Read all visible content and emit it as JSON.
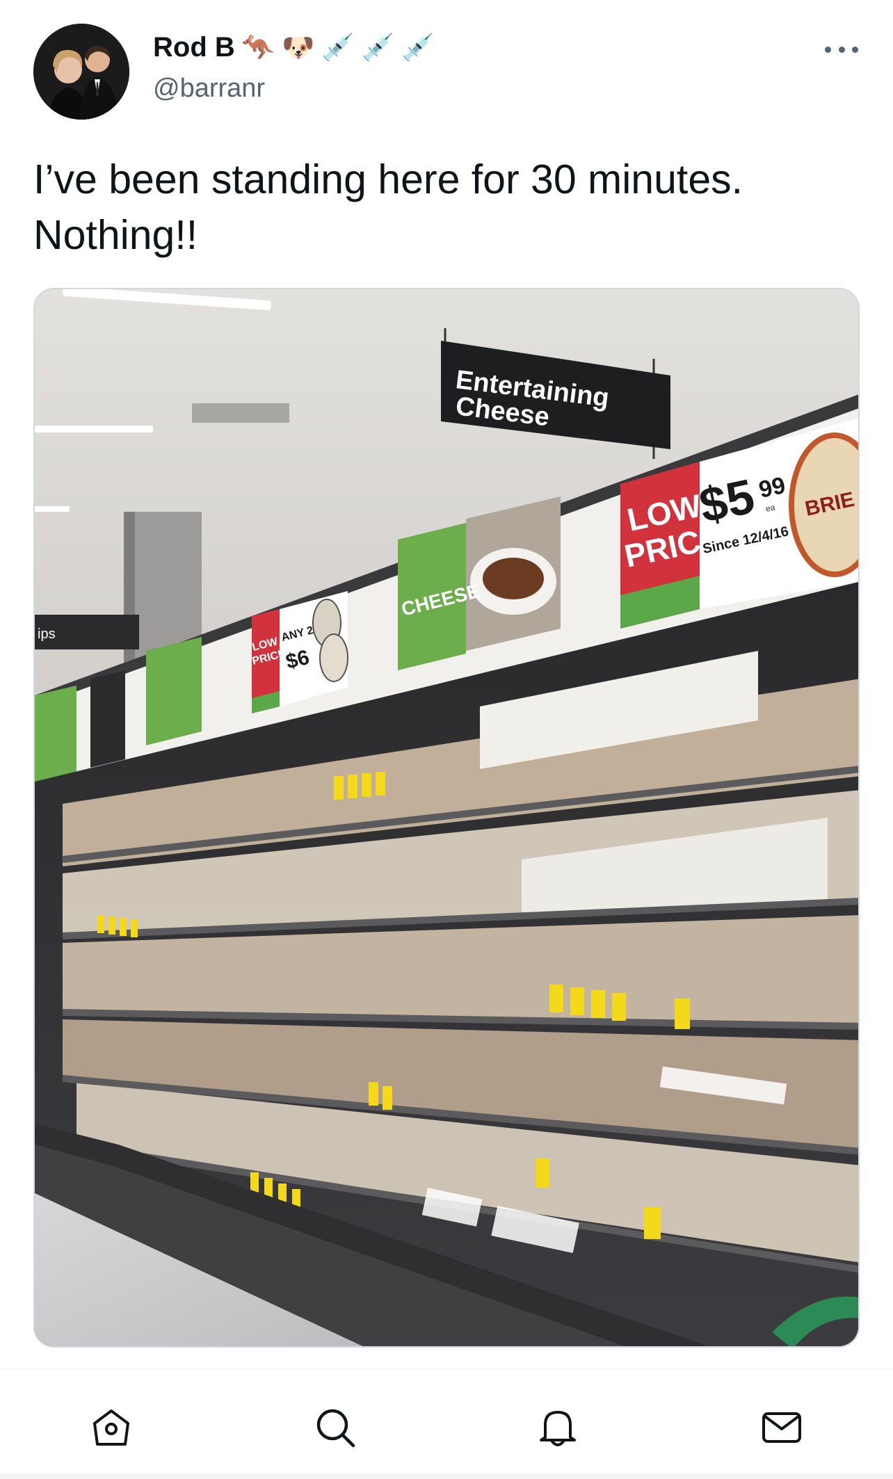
{
  "tweet": {
    "display_name": "Rod B",
    "handle": "@barranr",
    "name_emojis": [
      "🦘",
      "🐶",
      "💉",
      "💉",
      "💉"
    ],
    "text": "I’ve been standing here for 30 minutes.\nNothing!!"
  },
  "photo": {
    "hanging_sign_line1": "Entertaining",
    "hanging_sign_line2": "Cheese",
    "low_price_line1": "LOW",
    "low_price_line2": "PRICE",
    "price": "$5",
    "price_cents": "99",
    "price_unit": "ea",
    "price_since": "Since 12/4/16",
    "brie_label": "BRIE",
    "cheese_panel": "CHEESE",
    "small_low_price_line1": "LOW",
    "small_low_price_line2": "PRICE",
    "small_any": "ANY 2",
    "small_price": "$6",
    "left_sign": "ips"
  },
  "nav": {
    "icons": [
      "home-icon",
      "search-icon",
      "notifications-icon",
      "messages-icon"
    ]
  },
  "colors": {
    "text_primary": "#0f1419",
    "text_secondary": "#536471",
    "low_price_red": "#d1323c",
    "woolworths_green": "#5aa84a"
  }
}
